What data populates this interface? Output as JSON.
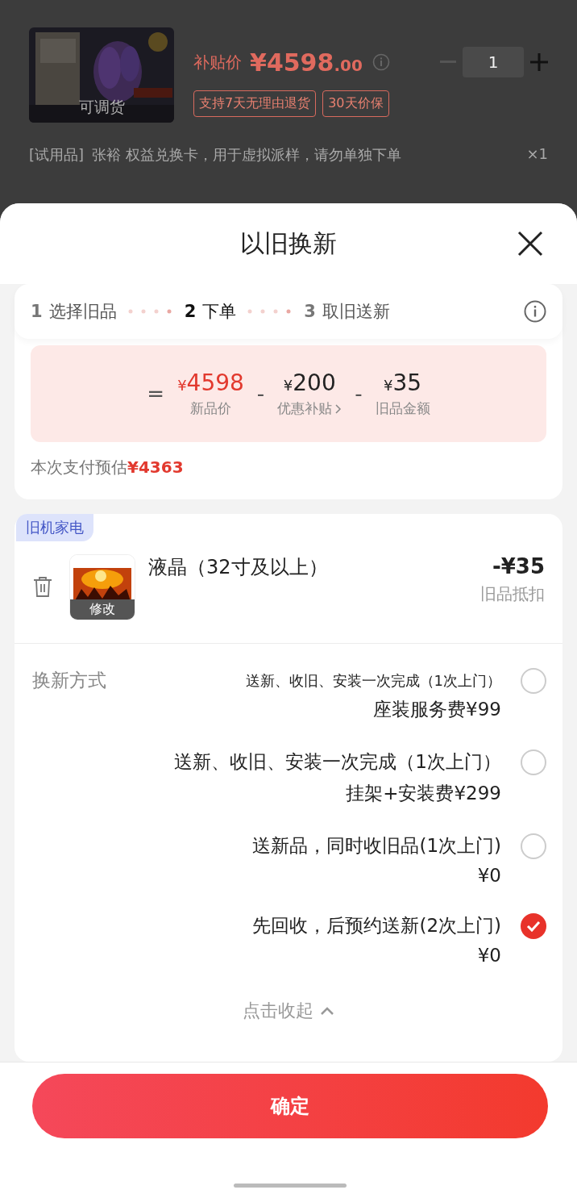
{
  "background_page": {
    "product": {
      "image_badge": "可调货",
      "price_label": "补贴价",
      "currency": "¥",
      "price_integer": "4598",
      "price_decimal": ".00",
      "quantity": "1",
      "tags": [
        "支持7天无理由退货",
        "30天价保"
      ]
    },
    "gift": {
      "tag": "[试用品]",
      "name": "张裕 权益兑换卡，用于虚拟派样，请勿单独下单",
      "count": "×1"
    }
  },
  "sheet": {
    "title": "以旧换新",
    "steps": [
      {
        "number": "1",
        "label": "选择旧品",
        "selected": false
      },
      {
        "number": "2",
        "label": "下单",
        "selected": true
      },
      {
        "number": "3",
        "label": "取旧送新",
        "selected": false
      }
    ],
    "breakdown": {
      "equals": "=",
      "items": [
        {
          "currency": "¥",
          "amount": "4598",
          "label": "新品价",
          "highlight": true,
          "link": false
        },
        {
          "operator": "-",
          "currency": "¥",
          "amount": "200",
          "label": "优惠补贴",
          "highlight": false,
          "link": true
        },
        {
          "operator": "-",
          "currency": "¥",
          "amount": "35",
          "label": "旧品金额",
          "highlight": false,
          "link": false
        }
      ]
    },
    "estimate": {
      "label": "本次支付预估",
      "amount": "¥4363"
    },
    "old_item": {
      "category_tag": "旧机家电",
      "name": "液晶（32寸及以上）",
      "edit_label": "修改",
      "amount": "-¥35",
      "amount_label": "旧品抵扣"
    },
    "method_label": "换新方式",
    "options": [
      {
        "title": "送新、收旧、安装一次完成（1次上门）",
        "price": "座装服务费¥99",
        "selected": false
      },
      {
        "title": "送新、收旧、安装一次完成（1次上门）",
        "price": "挂架+安装费¥299",
        "selected": false
      },
      {
        "title": "送新品，同时收旧品(1次上门)",
        "price": "¥0",
        "selected": false
      },
      {
        "title": "先回收，后预约送新(2次上门)",
        "price": "¥0",
        "selected": true
      }
    ],
    "collapse": "点击收起",
    "confirm": "确定"
  }
}
